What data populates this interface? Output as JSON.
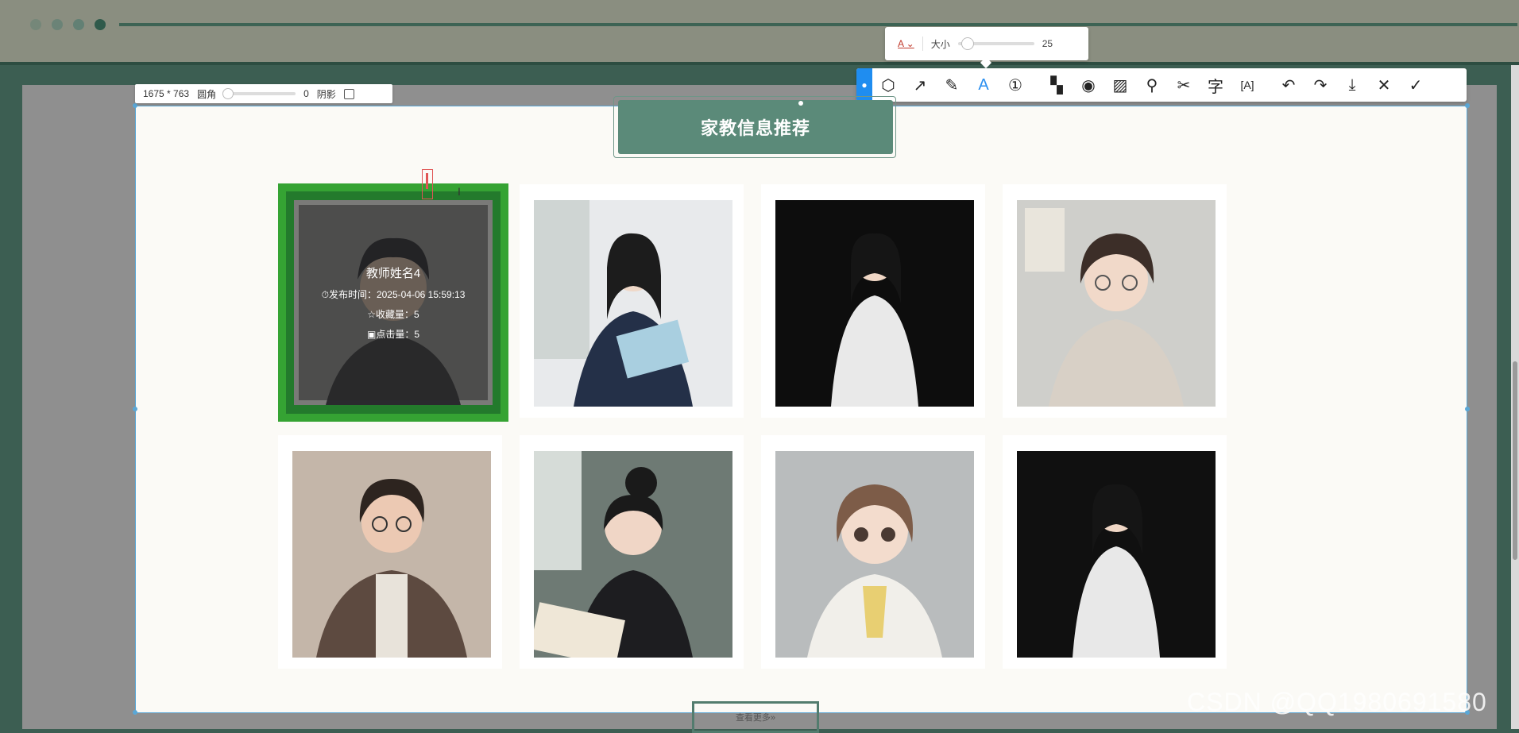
{
  "window": {
    "dots": 4
  },
  "size_bar": {
    "dimensions": "1675 * 763",
    "radius_label": "圆角",
    "radius_value": "0",
    "shadow_label": "阴影"
  },
  "text_tool": {
    "font_icon": "A",
    "size_label": "大小",
    "size_value": "25"
  },
  "toolbar": {
    "icons": [
      "shape-icon",
      "arrow-icon",
      "pen-icon",
      "text-icon",
      "number-icon",
      "mosaic-icon",
      "blur-icon",
      "hatch-icon",
      "pin-icon",
      "scissors-icon",
      "translate-icon",
      "ocr-icon",
      "undo-icon",
      "redo-icon",
      "download-icon",
      "close-icon",
      "confirm-icon"
    ],
    "glyphs": [
      "⬡",
      "↗",
      "✎",
      "A",
      "①",
      "▚",
      "◉",
      "▨",
      "⚲",
      "✂",
      "字",
      "[A]",
      "↶",
      "↷",
      "⤓",
      "✕",
      "✓"
    ]
  },
  "page": {
    "title": "家教信息推荐",
    "more_label": "查看更多»"
  },
  "featured": {
    "name": "教师姓名4",
    "publish": "⏱发布时间：2025-04-06 15:59:13",
    "favorites": "☆收藏量：5",
    "clicks": "▣点击量：5"
  },
  "watermark": "CSDN @QQ1980691580"
}
